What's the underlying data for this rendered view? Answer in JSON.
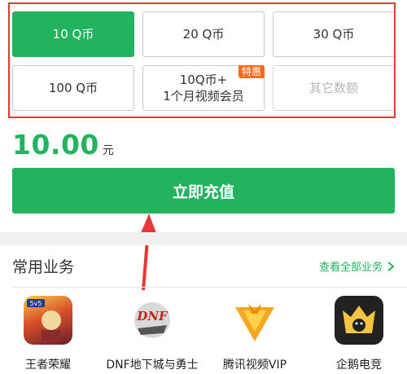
{
  "options": [
    {
      "label": "10 Q币",
      "selected": true
    },
    {
      "label": "20 Q币",
      "selected": false
    },
    {
      "label": "30 Q币",
      "selected": false
    },
    {
      "label": "100 Q币",
      "selected": false
    },
    {
      "line1": "10Q币+",
      "line2": "1个月视频会员",
      "badge": "特惠",
      "selected": false
    },
    {
      "label": "其它数额",
      "selected": false
    }
  ],
  "amount": {
    "value": "10.00",
    "unit": "元"
  },
  "pay_button": {
    "label": "立即充值"
  },
  "section": {
    "title": "常用业务",
    "see_all": "查看全部业务",
    "see_all_icon": "chevron-right-icon"
  },
  "apps": [
    {
      "label": "王者荣耀",
      "icon": "honor-of-kings-icon"
    },
    {
      "label": "DNF地下城与勇士",
      "icon": "dnf-icon"
    },
    {
      "label": "腾讯视频VIP",
      "icon": "tencent-video-icon"
    },
    {
      "label": "企鹅电竞",
      "icon": "penguin-esports-icon"
    }
  ],
  "colors": {
    "accent": "#22b35e",
    "badge": "#ff6a1a",
    "annotation": "#e53935"
  }
}
